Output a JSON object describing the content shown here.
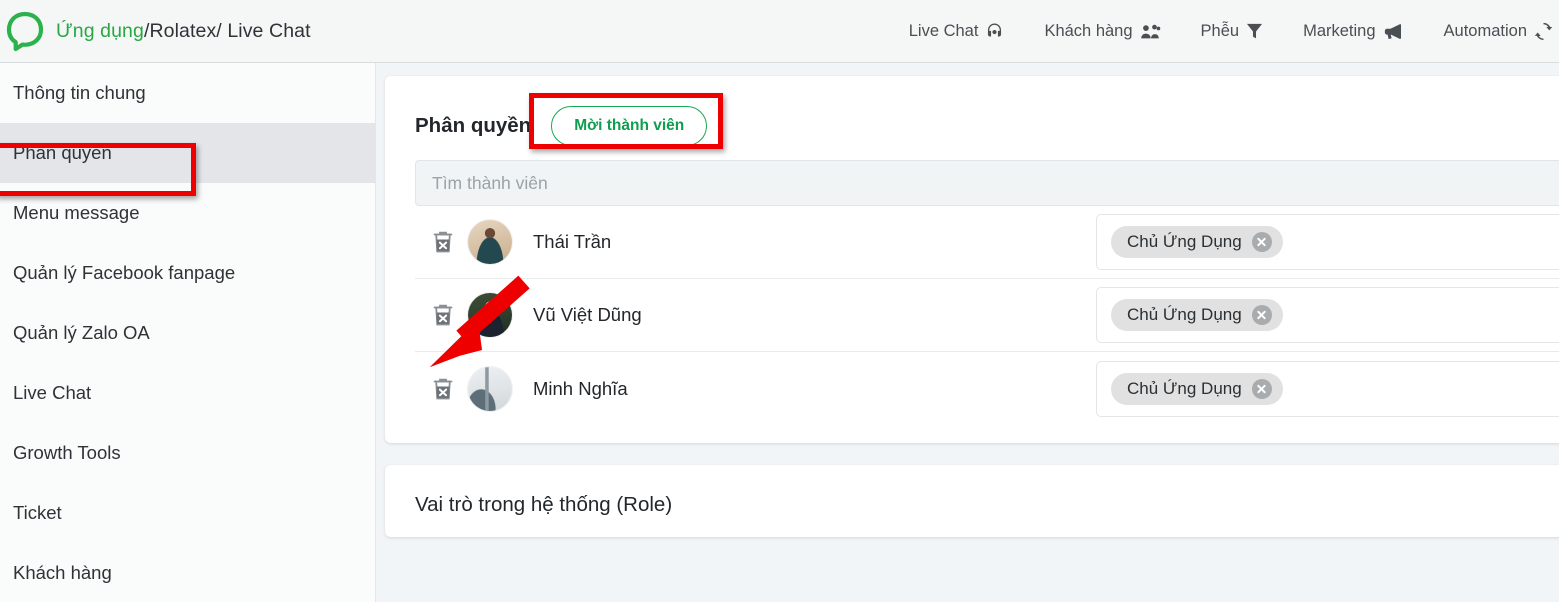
{
  "app": {
    "logo_icon": "chat-bubble-logo",
    "breadcrumb_green": "Ứng dụng",
    "breadcrumb_rest": "/Rolatex/ Live Chat",
    "accent_green": "#28a745",
    "annotation_red": "#ee0000"
  },
  "topnav": {
    "items": [
      {
        "label": "Live Chat",
        "icon": "headset-icon"
      },
      {
        "label": "Khách hàng",
        "icon": "people-icon"
      },
      {
        "label": "Phễu",
        "icon": "funnel-icon"
      },
      {
        "label": "Marketing",
        "icon": "megaphone-icon"
      },
      {
        "label": "Automation",
        "icon": "sync-icon"
      }
    ]
  },
  "sidebar": {
    "items": [
      {
        "label": "Thông tin chung",
        "active": false
      },
      {
        "label": "Phân quyền",
        "active": true
      },
      {
        "label": "Menu message",
        "active": false
      },
      {
        "label": "Quản lý Facebook fanpage",
        "active": false
      },
      {
        "label": "Quản lý Zalo OA",
        "active": false
      },
      {
        "label": "Live Chat",
        "active": false
      },
      {
        "label": "Growth Tools",
        "active": false
      },
      {
        "label": "Ticket",
        "active": false
      },
      {
        "label": "Khách hàng",
        "active": false
      }
    ]
  },
  "permissions": {
    "title": "Phân quyền",
    "invite_button": "Mời thành viên",
    "search_placeholder": "Tìm thành viên",
    "search_value": "",
    "members": [
      {
        "name": "Thái Trần",
        "delete_icon": "trash-delete-icon",
        "avatar": "avatar-thai-tran",
        "role_tag": "Chủ Ứng Dụng",
        "role_remove_icon": "remove-tag-icon"
      },
      {
        "name": "Vũ Việt Dũng",
        "delete_icon": "trash-delete-icon",
        "avatar": "avatar-vu-viet-dung",
        "role_tag": "Chủ Ứng Dụng",
        "role_remove_icon": "remove-tag-icon"
      },
      {
        "name": "Minh Nghĩa",
        "delete_icon": "trash-delete-icon",
        "avatar": "avatar-minh-nghia",
        "role_tag": "Chủ Ứng Dụng",
        "role_remove_icon": "remove-tag-icon"
      }
    ]
  },
  "roles_section": {
    "title": "Vai trò trong hệ thống (Role)"
  },
  "annotations": {
    "sidebar_highlight": "red-box-phan-quyen",
    "invite_highlight": "red-box-moi-thanh-vien",
    "arrow": "red-arrow-to-delete-icon"
  }
}
